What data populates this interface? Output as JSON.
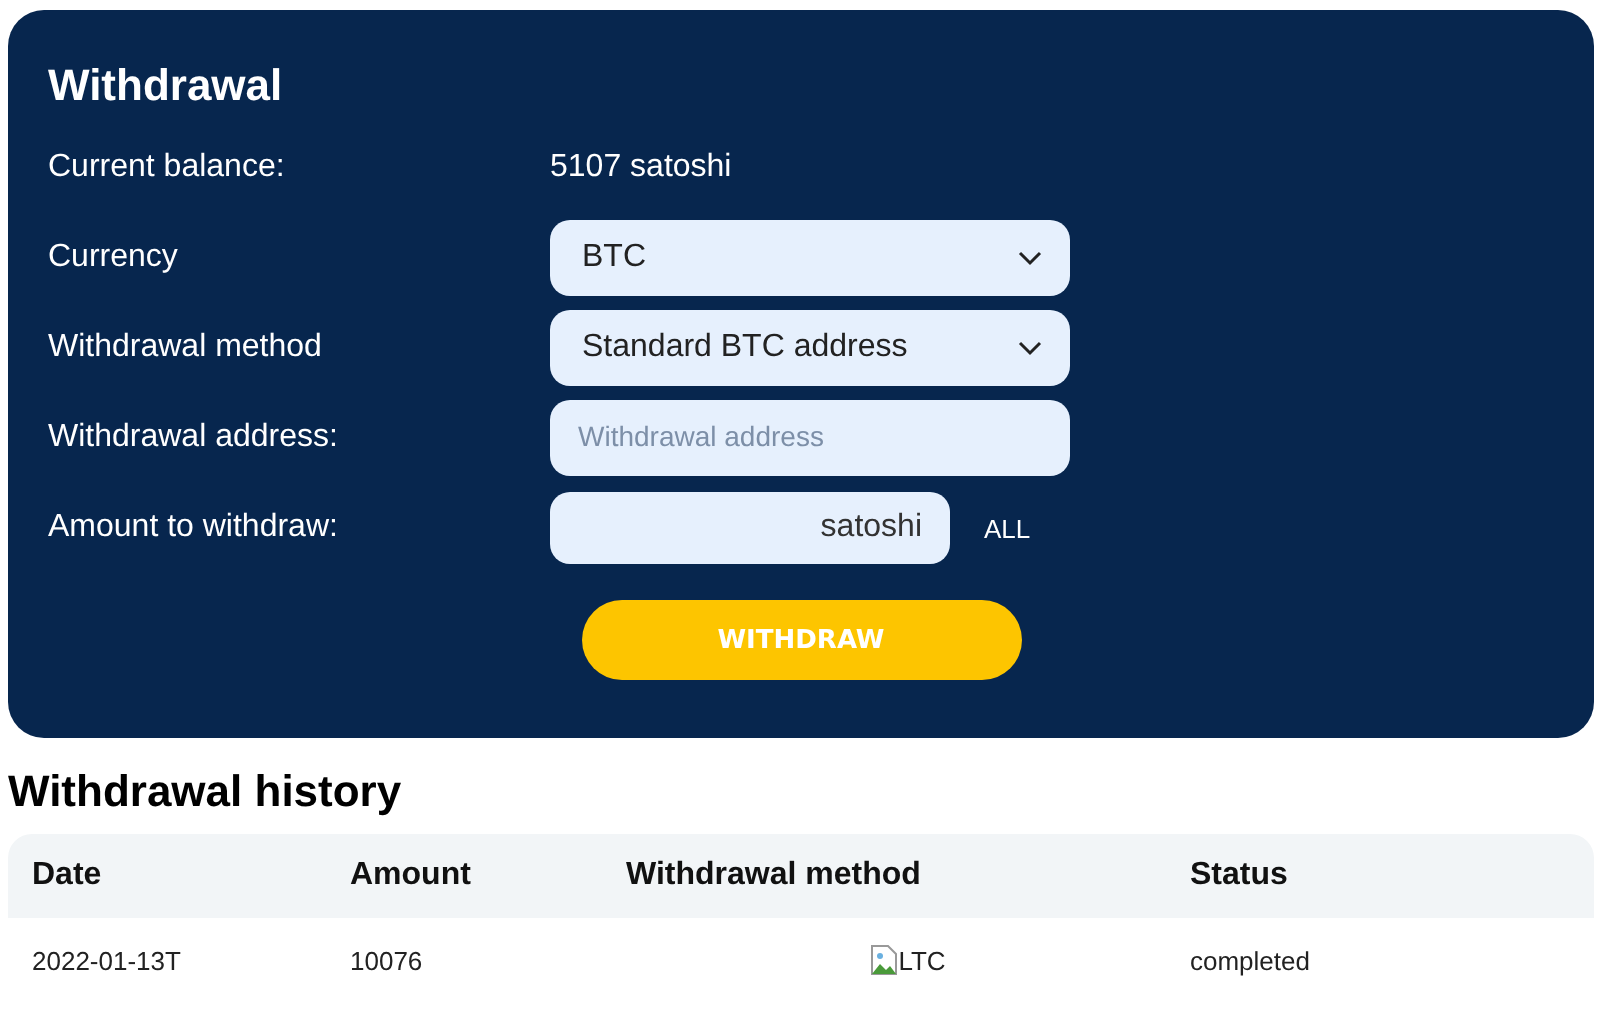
{
  "withdrawal": {
    "title": "Withdrawal",
    "rows": [
      {
        "kind": "text",
        "label": "Current balance:",
        "value": "5107 satoshi"
      },
      {
        "kind": "select",
        "label": "Currency",
        "value": "BTC"
      },
      {
        "kind": "select",
        "label": "Withdrawal method",
        "value": "Standard BTC address"
      },
      {
        "kind": "input",
        "label": "Withdrawal address:",
        "placeholder": "Withdrawal address"
      },
      {
        "kind": "amount",
        "label": "Amount to withdraw:",
        "suffix": "satoshi",
        "link": "ALL"
      }
    ],
    "button": "WITHDRAW"
  },
  "history": {
    "title": "Withdrawal history",
    "columns": [
      "Date",
      "Amount",
      "Withdrawal method",
      "Status"
    ],
    "rows": [
      {
        "date": "2022-01-13T",
        "amount": "10076",
        "method": "LTC",
        "status": "completed"
      }
    ]
  }
}
